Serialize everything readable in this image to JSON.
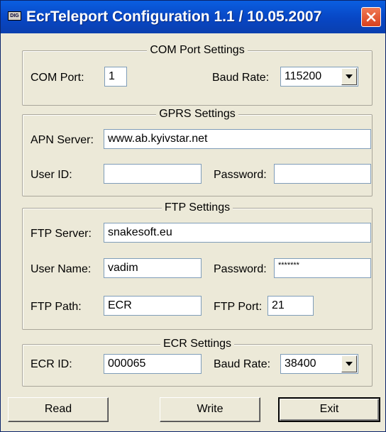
{
  "window": {
    "title": "EcrTeleport Configuration 1.1 / 10.05.2007",
    "icon": "app-icon"
  },
  "com": {
    "legend": "COM Port Settings",
    "port_label": "COM Port:",
    "port_value": "1",
    "baud_label": "Baud Rate:",
    "baud_value": "115200"
  },
  "gprs": {
    "legend": "GPRS Settings",
    "apn_label": "APN Server:",
    "apn_value": "www.ab.kyivstar.net",
    "user_label": "User ID:",
    "user_value": "",
    "password_label": "Password:",
    "password_value": ""
  },
  "ftp": {
    "legend": "FTP Settings",
    "server_label": "FTP Server:",
    "server_value": "snakesoft.eu",
    "user_label": "User Name:",
    "user_value": "vadim",
    "password_label": "Password:",
    "password_value": "*******",
    "path_label": "FTP Path:",
    "path_value": "ECR",
    "port_label": "FTP Port:",
    "port_value": "21"
  },
  "ecr": {
    "legend": "ECR Settings",
    "id_label": "ECR ID:",
    "id_value": "000065",
    "baud_label": "Baud Rate:",
    "baud_value": "38400"
  },
  "buttons": {
    "read": "Read",
    "write": "Write",
    "exit": "Exit"
  }
}
